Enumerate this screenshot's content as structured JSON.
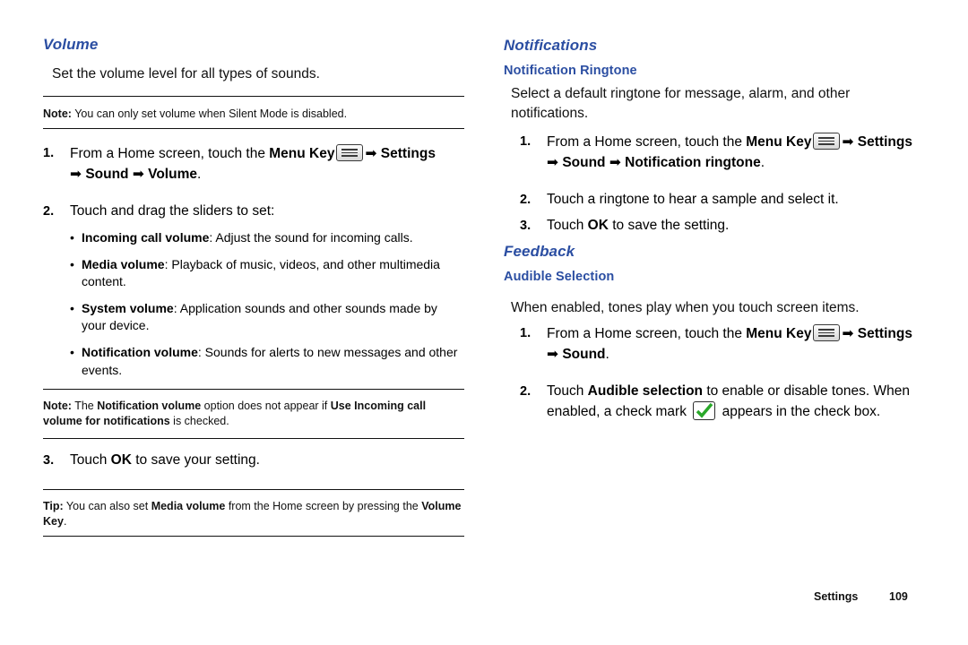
{
  "left": {
    "heading": "Volume",
    "intro": "Set the volume level for all types of sounds.",
    "note1_label": "Note:",
    "note1_text": " You can only set volume when Silent Mode is disabled.",
    "step1_num": "1.",
    "step1_a": "From a Home screen, touch the ",
    "step1_menukey": "Menu Key",
    "step1_b": "Settings",
    "step1_c": "Sound",
    "step1_d": "Volume",
    "step2_num": "2.",
    "step2_text": "Touch and drag the sliders to set:",
    "bullets": [
      {
        "term": "Incoming call volume",
        "rest": ": Adjust the sound for incoming calls."
      },
      {
        "term": "Media volume",
        "rest": ": Playback of music, videos, and other multimedia content."
      },
      {
        "term": "System volume",
        "rest": ": Application sounds and other sounds made by your device."
      },
      {
        "term": "Notification volume",
        "rest": ": Sounds for alerts to new messages and other events."
      }
    ],
    "note2_label": "Note:",
    "note2_a": " The ",
    "note2_b": "Notification volume",
    "note2_c": " option does not appear if ",
    "note2_d": "Use Incoming call volume for notifications",
    "note2_e": " is checked.",
    "step3_num": "3.",
    "step3_a": "Touch ",
    "step3_ok": "OK",
    "step3_b": " to save your setting.",
    "tip_label": "Tip:",
    "tip_a": " You can also set ",
    "tip_b": "Media volume",
    "tip_c": " from the Home screen by pressing the ",
    "tip_d": "Volume Key",
    "tip_e": "."
  },
  "right": {
    "heading1": "Notifications",
    "sub1": "Notification Ringtone",
    "intro1": "Select a default ringtone for message, alarm, and other notifications.",
    "r_step1_num": "1.",
    "r_step1_a": "From a Home screen, touch the ",
    "r_step1_menukey": "Menu Key",
    "r_step1_b": "Settings",
    "r_step1_c": "Sound",
    "r_step1_d": "Notification ringtone",
    "r_step2_num": "2.",
    "r_step2_text": "Touch a ringtone to hear a sample and select it.",
    "r_step3_num": "3.",
    "r_step3_a": "Touch ",
    "r_step3_ok": "OK",
    "r_step3_b": " to save the setting.",
    "heading2": "Feedback",
    "sub2": "Audible Selection",
    "intro2": "When enabled, tones play when you touch screen items.",
    "f_step1_num": "1.",
    "f_step1_a": "From a Home screen, touch the ",
    "f_step1_menukey": "Menu Key",
    "f_step1_b": "Settings",
    "f_step1_c": "Sound",
    "f_step2_num": "2.",
    "f_step2_a": "Touch ",
    "f_step2_b": "Audible selection",
    "f_step2_c": " to enable or disable tones. When enabled, a check mark ",
    "f_step2_d": " appears in the check box."
  },
  "footer": {
    "label": "Settings",
    "page": "109"
  },
  "icons": {
    "menu_key": "menu-key-icon",
    "check_box": "checkbox-checked-icon",
    "arrow": "➡"
  },
  "colors": {
    "heading": "#2b4ea2",
    "text": "#111111",
    "check": "#2aa82a"
  }
}
